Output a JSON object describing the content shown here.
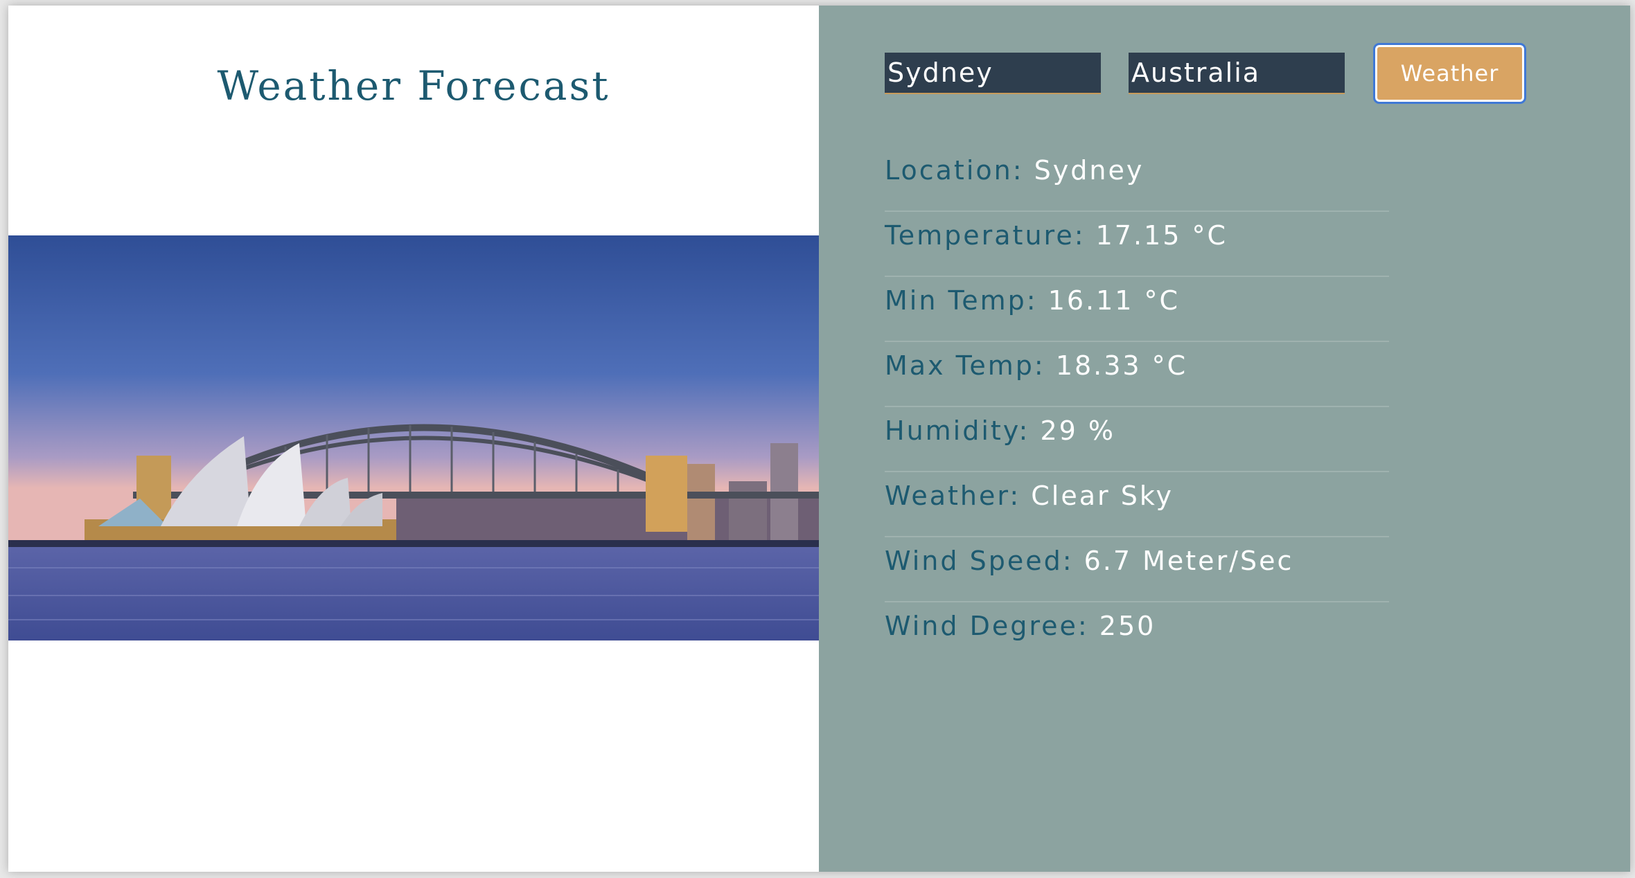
{
  "header": {
    "title": "Weather Forecast"
  },
  "search": {
    "city_value": "Sydney",
    "country_value": "Australia",
    "button_label": "Weather"
  },
  "details": [
    {
      "label": "Location:",
      "value": "Sydney"
    },
    {
      "label": "Temperature:",
      "value": "17.15 °C"
    },
    {
      "label": "Min Temp:",
      "value": "16.11 °C"
    },
    {
      "label": "Max Temp:",
      "value": "18.33 °C"
    },
    {
      "label": "Humidity:",
      "value": "29 %"
    },
    {
      "label": "Weather:",
      "value": "Clear Sky"
    },
    {
      "label": "Wind Speed:",
      "value": "6.7 Meter/Sec"
    },
    {
      "label": "Wind Degree:",
      "value": "250"
    }
  ],
  "colors": {
    "title": "#1d5a70",
    "panel": "#8ca3a0",
    "input_bg": "#2e3e4e",
    "button": "#d9a463"
  },
  "image": {
    "icon": "sydney-harbour-photo"
  }
}
